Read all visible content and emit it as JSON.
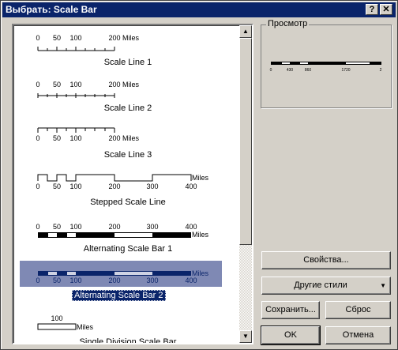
{
  "window": {
    "title": "Выбрать: Scale Bar",
    "help_btn": "?",
    "close_btn": "✕"
  },
  "list": {
    "items": [
      {
        "label": "Scale Line 1",
        "ticks": [
          "0",
          "50",
          "100",
          "200"
        ],
        "unit": "Miles"
      },
      {
        "label": "Scale Line 2",
        "ticks": [
          "0",
          "50",
          "100",
          "200"
        ],
        "unit": "Miles"
      },
      {
        "label": "Scale Line 3",
        "ticks": [
          "0",
          "50",
          "100",
          "200"
        ],
        "unit": "Miles"
      },
      {
        "label": "Stepped Scale Line",
        "ticks": [
          "0",
          "50",
          "100",
          "200",
          "300",
          "400"
        ],
        "unit": "Miles"
      },
      {
        "label": "Alternating Scale Bar 1",
        "ticks": [
          "0",
          "50",
          "100",
          "200",
          "300",
          "400"
        ],
        "unit": "Miles"
      },
      {
        "label": "Alternating Scale Bar 2",
        "ticks": [
          "0",
          "50",
          "100",
          "200",
          "300",
          "400"
        ],
        "unit": "Miles",
        "selected": true
      },
      {
        "label": "Single Division Scale Bar",
        "ticks": [
          "100"
        ],
        "unit": "Miles"
      }
    ]
  },
  "preview": {
    "title": "Просмотр",
    "ticks": [
      "0",
      "430",
      "860",
      "1720",
      "2"
    ]
  },
  "buttons": {
    "properties": "Свойства...",
    "more_styles": "Другие стили",
    "save": "Сохранить...",
    "reset": "Сброс",
    "ok": "OK",
    "cancel": "Отмена"
  },
  "colors": {
    "title_bg": "#0a246a",
    "face": "#d4d0c8"
  }
}
